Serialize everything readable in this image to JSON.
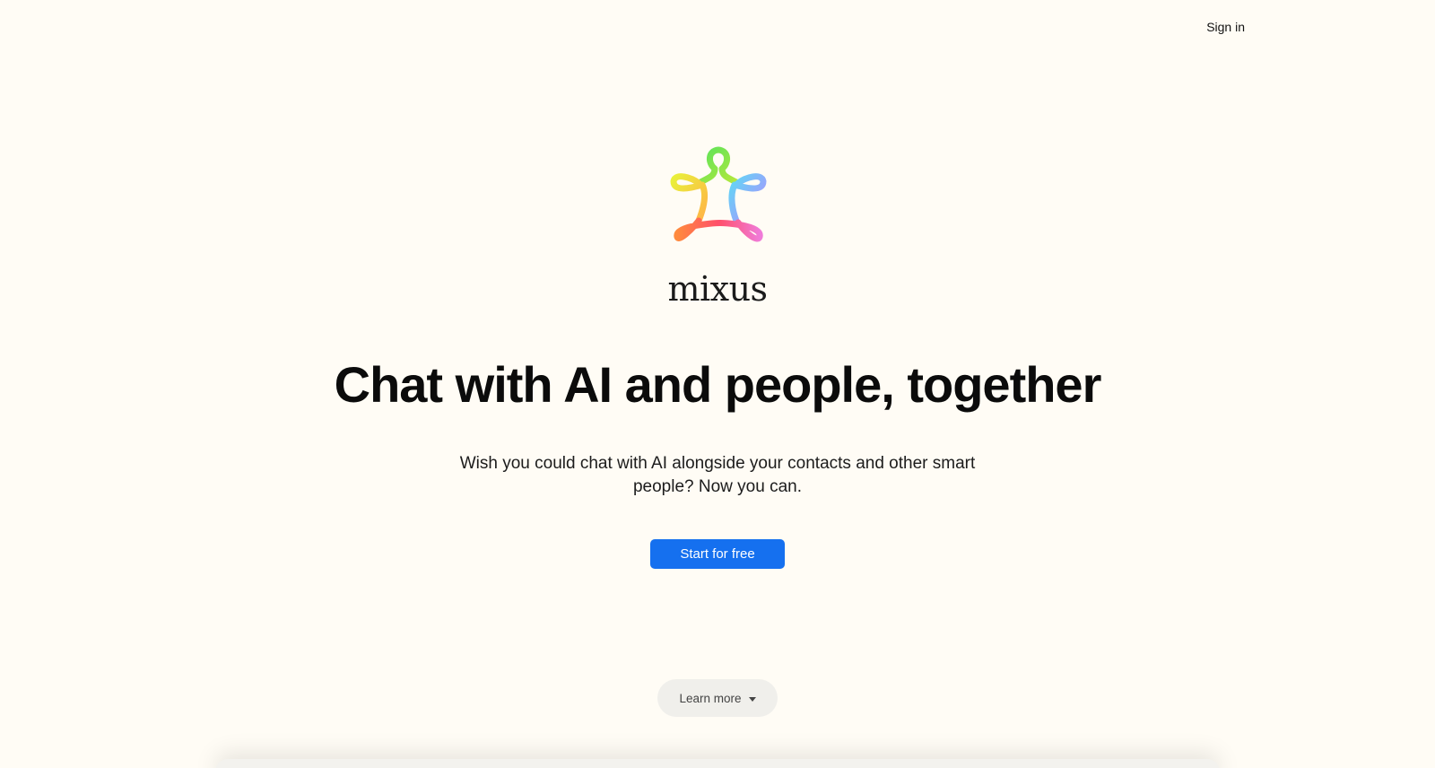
{
  "header": {
    "signin_label": "Sign in"
  },
  "brand": {
    "name": "mixus",
    "logo_icon": "mixus-rainbow-logo-icon"
  },
  "hero": {
    "headline": "Chat with AI and people, together",
    "subtitle": "Wish you could chat with AI alongside your contacts and other smart people? Now you can.",
    "cta_label": "Start for free"
  },
  "footer": {
    "learn_more_label": "Learn more",
    "learn_more_icon": "chevron-down-icon"
  },
  "colors": {
    "background": "#fffcf5",
    "cta": "#1570ef",
    "learn_more_bg": "#f0efeb"
  }
}
